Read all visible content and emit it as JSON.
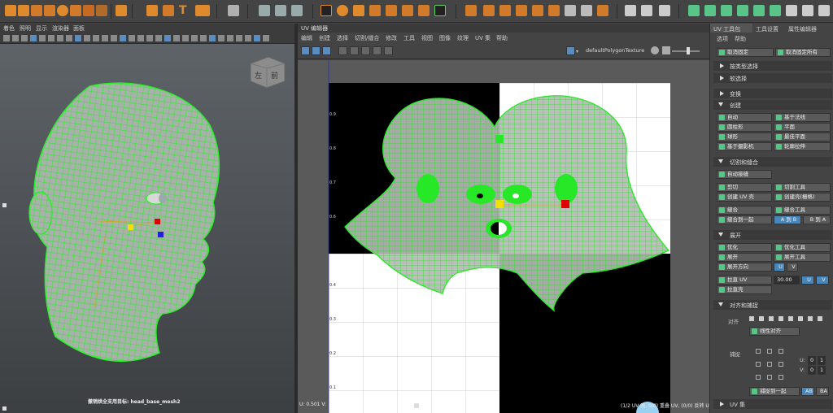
{
  "viewport": {
    "menu": [
      "着色",
      "照明",
      "显示",
      "渲染器",
      "面板"
    ],
    "viewcube": {
      "left": "左",
      "front": "前"
    },
    "status": "撤销烘全支用目标: head_base_mesh2"
  },
  "uv_editor": {
    "title": "UV 编辑器",
    "menu": [
      "编辑",
      "创建",
      "选择",
      "切割/缝合",
      "修改",
      "工具",
      "视图",
      "图像",
      "纹理",
      "UV 集",
      "帮助"
    ],
    "texture_name": "defaultPolygonTexture",
    "axis_labels": [
      "0.9",
      "0.8",
      "0.7",
      "0.6",
      "0.4",
      "0.3",
      "0.2",
      "0.1"
    ],
    "status_left": "U: 0.501 V:",
    "status_right": "(1/2 UV 壳, 0/0) 重叠 UV, (0/0) 反转 UV"
  },
  "right_panel": {
    "tabs": [
      "UV 工具包",
      "工具设置",
      "属性编辑器"
    ],
    "menu": [
      "选项",
      "帮助"
    ],
    "pin": "取消固定",
    "unpin_all": "取消固定所有",
    "sections": {
      "select_by_type": "按类型选择",
      "soft_select": "软选择",
      "transform": "变换",
      "create": "创建",
      "cut_sew": "切割和缝合",
      "unfold": "展开",
      "align_snap": "对齐和捕捉",
      "uv_sets": "UV 集"
    },
    "create_buttons": [
      "自动",
      "基于法线",
      "圆柱形",
      "平面",
      "球形",
      "最佳平面",
      "基于摄影机",
      "轮廓拉伸"
    ],
    "cut_buttons": {
      "auto_seams": "自动接缝",
      "cut": "剪切",
      "cut_tool": "切割工具",
      "create_shell": "创建 UV 壳",
      "create_shell_grid": "创建壳(栅格)",
      "sew": "缝合",
      "sew_tool": "缝合工具",
      "sew_together": "缝合到一起",
      "a_to_b": "A 到 B",
      "b_to_a": "B 到 A"
    },
    "unfold_buttons": {
      "optimize": "优化",
      "optimize_tool": "优化工具",
      "unfold": "展开",
      "unfold_tool": "展开工具",
      "unfold_dir": "展开方向",
      "u": "U",
      "v": "V",
      "straighten": "拉直 UV",
      "angle": "30.00",
      "straighten_shell": "拉直壳"
    },
    "align": {
      "align_label": "对齐",
      "linear_align": "线性对齐",
      "snap_label": "捕捉",
      "u_label": "U:",
      "v_label": "V:",
      "u0": "0",
      "u1": "1",
      "v0": "0",
      "v1": "1",
      "snap_together": "捕捉到一起",
      "ab": "AB",
      "ba": "BA"
    }
  },
  "colors": {
    "wire": "#22ee22",
    "accent": "#4b86b8",
    "panel": "#444444"
  }
}
